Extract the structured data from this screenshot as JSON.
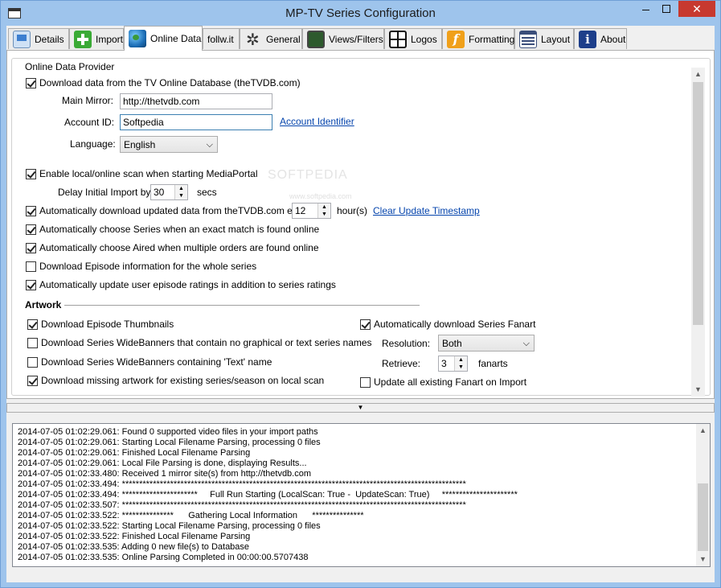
{
  "window": {
    "title": "MP-TV Series Configuration",
    "close_glyph": "✕"
  },
  "tabs": [
    {
      "label": "Details",
      "icon": "monitor-icon"
    },
    {
      "label": "Import",
      "icon": "plus-icon"
    },
    {
      "label": "Online Data",
      "icon": "globe-icon"
    },
    {
      "label": "follw.it",
      "icon": ""
    },
    {
      "label": "General",
      "icon": "gear-icon"
    },
    {
      "label": "Views/Filters",
      "icon": "screen-icon"
    },
    {
      "label": "Logos",
      "icon": "grid-icon"
    },
    {
      "label": "Formatting",
      "icon": "f-icon"
    },
    {
      "label": "Layout",
      "icon": "layout-icon"
    },
    {
      "label": "About",
      "icon": "info-icon"
    }
  ],
  "active_tab": "Online Data",
  "online": {
    "group_title": "Online Data Provider",
    "download_label": "Download data from the TV Online Database (theTVDB.com)",
    "download_checked": true,
    "mirror_label": "Main Mirror:",
    "mirror_value": "http://thetvdb.com",
    "account_label": "Account ID:",
    "account_value": "Softpedia",
    "account_link": "Account Identifier",
    "language_label": "Language:",
    "language_value": "English",
    "enable_scan_label": "Enable local/online scan when starting MediaPortal",
    "enable_scan_checked": true,
    "delay_label": "Delay Initial Import by:",
    "delay_value": "30",
    "delay_unit": "secs",
    "auto_update_label": "Automatically download updated data from theTVDB.com every:",
    "auto_update_checked": true,
    "auto_update_value": "12",
    "auto_update_unit": "hour(s)",
    "clear_link": "Clear Update Timestamp",
    "choose_series_label": "Automatically choose Series when an exact match is found online",
    "choose_series_checked": true,
    "choose_aired_label": "Automatically choose Aired when multiple orders are found online",
    "choose_aired_checked": true,
    "episode_info_label": "Download Episode information for the whole series",
    "episode_info_checked": false,
    "ratings_label": "Automatically update user episode ratings in addition to series ratings",
    "ratings_checked": true
  },
  "artwork": {
    "header": "Artwork",
    "thumbs_label": "Download Episode Thumbnails",
    "thumbs_checked": true,
    "widebanners_nogfx_label": "Download Series WideBanners that contain no graphical or text series names",
    "widebanners_nogfx_checked": false,
    "widebanners_text_label": "Download Series WideBanners containing 'Text' name",
    "widebanners_text_checked": false,
    "missing_label": "Download missing artwork for existing series/season on local scan",
    "missing_checked": true,
    "fanart_label": "Automatically download Series Fanart",
    "fanart_checked": true,
    "resolution_label": "Resolution:",
    "resolution_value": "Both",
    "retrieve_label": "Retrieve:",
    "retrieve_value": "3",
    "retrieve_unit": "fanarts",
    "update_fanart_label": "Update all existing Fanart on Import",
    "update_fanart_checked": false
  },
  "watermark": {
    "main": "SOFTPEDIA",
    "sub": "www.softpedia.com"
  },
  "splitter_glyph": "▼",
  "scroll": {
    "up": "▲",
    "down": "▼"
  },
  "log": [
    "2014-07-05 01:02:29.061: Found 0 supported video files in your import paths",
    "2014-07-05 01:02:29.061: Starting Local Filename Parsing, processing 0 files",
    "2014-07-05 01:02:29.061: Finished Local Filename Parsing",
    "2014-07-05 01:02:29.061: Local File Parsing is done, displaying Results...",
    "2014-07-05 01:02:33.480: Received 1 mirror site(s) from http://thetvdb.com",
    "2014-07-05 01:02:33.494: ****************************************************************************************************",
    "2014-07-05 01:02:33.494: **********************     Full Run Starting (LocalScan: True -  UpdateScan: True)     **********************",
    "2014-07-05 01:02:33.507: ****************************************************************************************************",
    "2014-07-05 01:02:33.522: ***************      Gathering Local Information      ***************",
    "2014-07-05 01:02:33.522: Starting Local Filename Parsing, processing 0 files",
    "2014-07-05 01:02:33.522: Finished Local Filename Parsing",
    "2014-07-05 01:02:33.535: Adding 0 new file(s) to Database",
    "2014-07-05 01:02:33.535: Online Parsing Completed in 00:00:00.5707438"
  ]
}
